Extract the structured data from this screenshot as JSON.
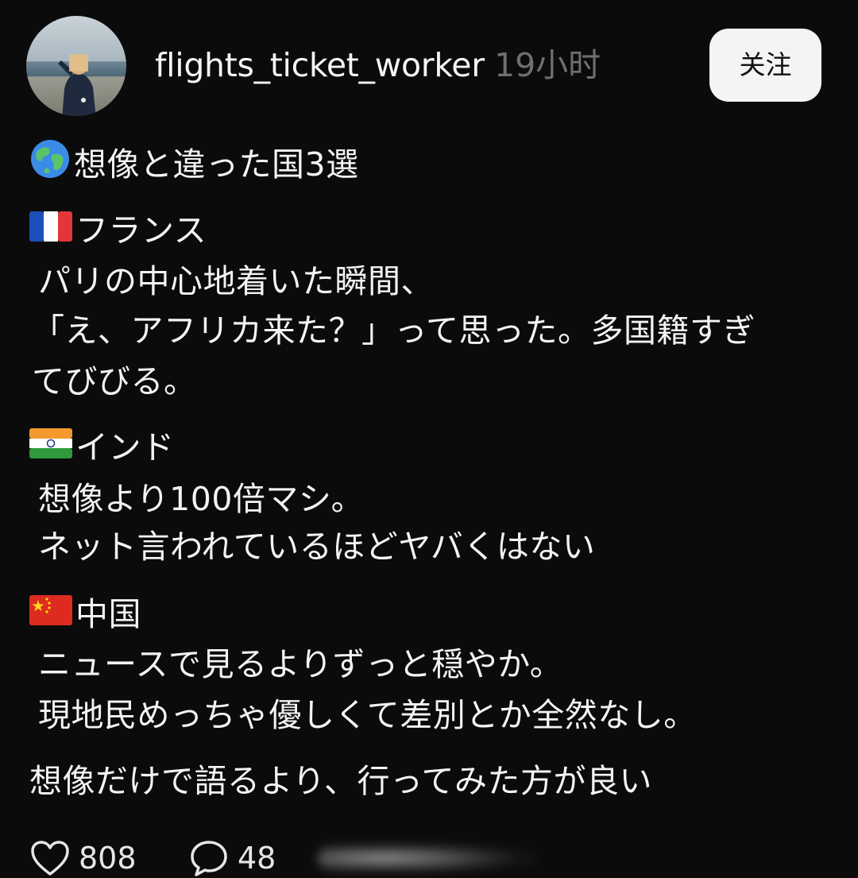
{
  "header": {
    "username": "flights_ticket_worker",
    "time": "19小时",
    "follow_label": "关注"
  },
  "post": {
    "title": "想像と違った国3選",
    "title_icon": "globe-icon",
    "sections": [
      {
        "flag": "france-flag-icon",
        "country": "フランス",
        "lines": [
          "パリの中心地着いた瞬間、",
          "「え、アフリカ来た？」って思った。多国籍すぎ",
          "てびびる。"
        ]
      },
      {
        "flag": "india-flag-icon",
        "country": "インド",
        "lines": [
          "想像より100倍マシ。",
          "ネット言われているほどヤバくはない"
        ]
      },
      {
        "flag": "china-flag-icon",
        "country": "中国",
        "lines": [
          "ニュースで見るよりずっと穏やか。",
          "現地民めっちゃ優しくて差別とか全然なし。"
        ]
      }
    ],
    "conclusion": "想像だけで語るより、行ってみた方が良い"
  },
  "actions": {
    "likes": "808",
    "comments": "48"
  },
  "colors": {
    "background": "#0b0b0b",
    "text": "#f3f3f3",
    "muted": "#6f6f6f",
    "button": "#f4f4f4"
  }
}
